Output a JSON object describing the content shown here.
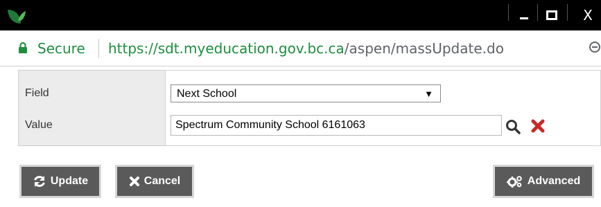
{
  "window": {
    "controls": {
      "minimize": "minimize",
      "maximize": "maximize",
      "close": "X"
    }
  },
  "address_bar": {
    "secure_label": "Secure",
    "url_host": "https://sdt.myeducation.gov.bc.ca",
    "url_path": "/aspen/massUpdate.do"
  },
  "form": {
    "field_label": "Field",
    "field_selected": "Next School",
    "value_label": "Value",
    "value_text": "Spectrum Community School 6161063"
  },
  "buttons": {
    "update": "Update",
    "cancel": "Cancel",
    "advanced": "Advanced"
  },
  "colors": {
    "secure_green": "#1e8e3e",
    "button_bg": "#5a5a5a",
    "delete_red": "#c62828",
    "label_panel": "#ececec"
  }
}
